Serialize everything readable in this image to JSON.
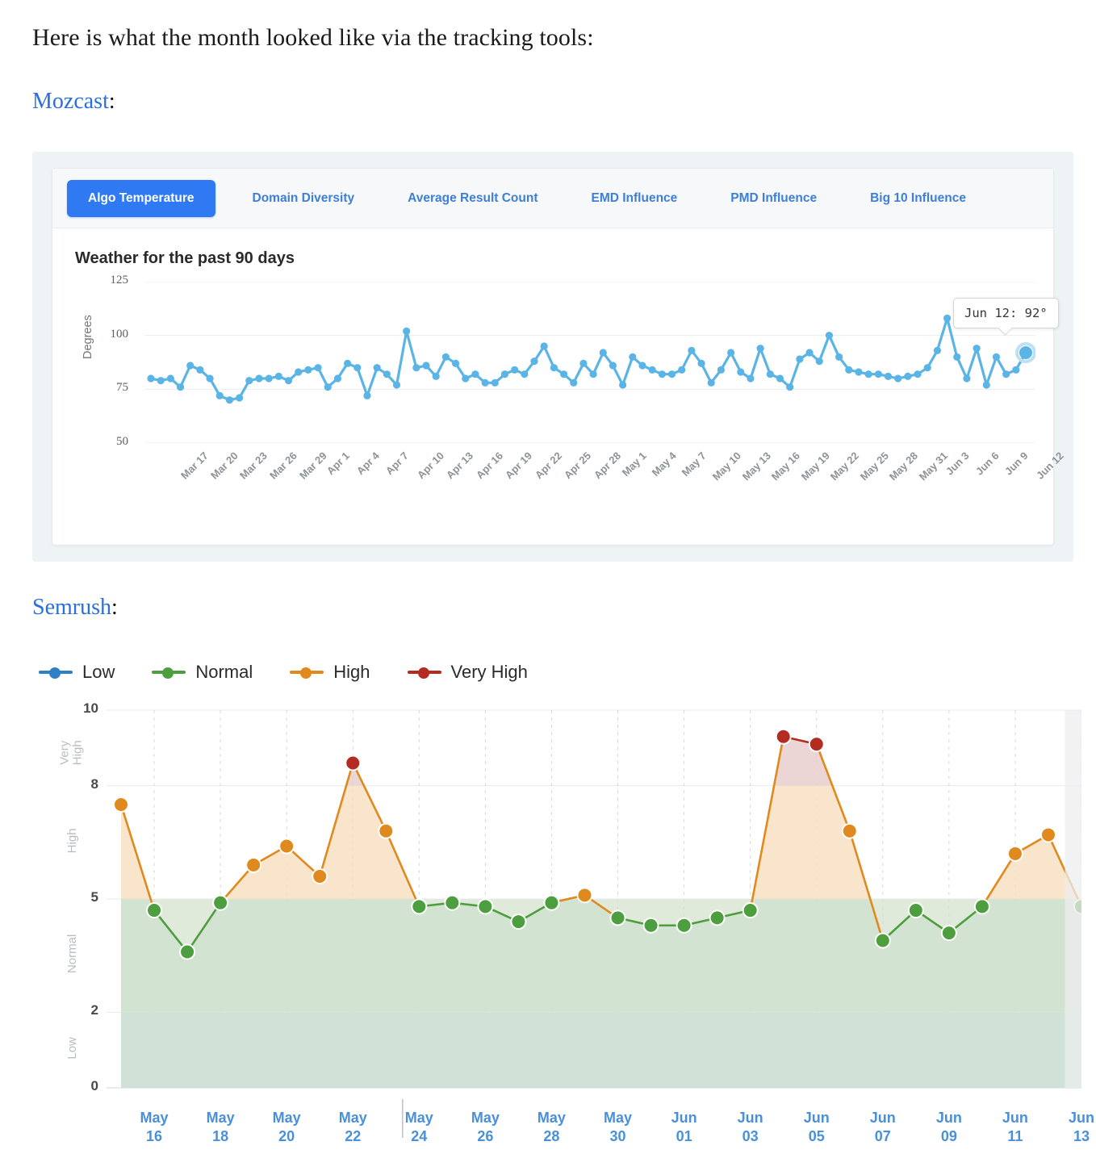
{
  "intro": {
    "paragraph": "Here is what the month looked like via the tracking tools:",
    "mozcast_label": "Mozcast",
    "mozcast_colon": ":",
    "semrush_label": "Semrush",
    "semrush_colon": ":"
  },
  "colors": {
    "link": "#2b6fdd",
    "tab_active_bg": "#2f7af3",
    "tab_text": "#3d7fd6",
    "mozcast_line": "#5ab4e5",
    "low": "#2f80c4",
    "normal": "#4d9e3f",
    "high": "#e08a1e",
    "very_high": "#b42b22",
    "band_low": "#d4e4f2",
    "band_normal": "#dfeada",
    "band_high": "#ffffff",
    "today_overlay": "#eceeef"
  },
  "mozcast": {
    "tabs": [
      {
        "label": "Algo Temperature",
        "active": true
      },
      {
        "label": "Domain Diversity",
        "active": false
      },
      {
        "label": "Average Result Count",
        "active": false
      },
      {
        "label": "EMD Influence",
        "active": false
      },
      {
        "label": "PMD Influence",
        "active": false
      },
      {
        "label": "Big 10 Influence",
        "active": false
      }
    ],
    "tooltip": "Jun 12: 92°",
    "chart_data": {
      "type": "line",
      "title": "Weather for the past 90 days",
      "xlabel": "",
      "ylabel": "Degrees",
      "ylim": [
        50,
        125
      ],
      "yticks": [
        125,
        100,
        75,
        50
      ],
      "grid": true,
      "legend": "none",
      "tick_labels": [
        "Mar 17",
        "Mar 20",
        "Mar 23",
        "Mar 26",
        "Mar 29",
        "Apr 1",
        "Apr 4",
        "Apr 7",
        "Apr 10",
        "Apr 13",
        "Apr 16",
        "Apr 19",
        "Apr 22",
        "Apr 25",
        "Apr 28",
        "May 1",
        "May 4",
        "May 7",
        "May 10",
        "May 13",
        "May 16",
        "May 19",
        "May 22",
        "May 25",
        "May 28",
        "May 31",
        "Jun 3",
        "Jun 6",
        "Jun 9",
        "Jun 12"
      ],
      "tick_every": 3,
      "x_start": "Mar 15",
      "values": [
        80,
        79,
        80,
        76,
        86,
        84,
        80,
        72,
        70,
        71,
        79,
        80,
        80,
        81,
        79,
        83,
        84,
        85,
        76,
        80,
        87,
        85,
        72,
        85,
        82,
        77,
        102,
        85,
        86,
        81,
        90,
        87,
        80,
        82,
        78,
        78,
        82,
        84,
        82,
        88,
        95,
        85,
        82,
        78,
        87,
        82,
        92,
        86,
        77,
        90,
        86,
        84,
        82,
        82,
        84,
        93,
        87,
        78,
        84,
        92,
        83,
        80,
        94,
        82,
        80,
        76,
        89,
        92,
        88,
        100,
        90,
        84,
        83,
        82,
        82,
        81,
        80,
        81,
        82,
        85,
        93,
        108,
        90,
        80,
        94,
        77,
        90,
        82,
        84,
        92
      ],
      "highlight_index": 89,
      "highlight_label": "Jun 12",
      "highlight_value": 92
    }
  },
  "semrush": {
    "legend": [
      {
        "label": "Low",
        "color": "#2f80c4"
      },
      {
        "label": "Normal",
        "color": "#4d9e3f"
      },
      {
        "label": "High",
        "color": "#e08a1e"
      },
      {
        "label": "Very High",
        "color": "#b42b22"
      }
    ],
    "chart_data": {
      "type": "line",
      "title": "",
      "xlabel": "",
      "ylabel": "",
      "ylim": [
        0,
        10
      ],
      "yticks": [
        10,
        8,
        5,
        2,
        0
      ],
      "grid": true,
      "legend_position": "top-left",
      "bands": [
        {
          "label": "Very High",
          "from": 8,
          "to": 10,
          "color": "#ffffff"
        },
        {
          "label": "High",
          "from": 5,
          "to": 8,
          "color": "#ffffff"
        },
        {
          "label": "Normal",
          "from": 2,
          "to": 5,
          "color": "#dfeada"
        },
        {
          "label": "Low",
          "from": 0,
          "to": 2,
          "color": "#d4e4f2"
        }
      ],
      "categories": [
        "May 15",
        "May 16",
        "May 17",
        "May 18",
        "May 19",
        "May 20",
        "May 21",
        "May 22",
        "May 23",
        "May 24",
        "May 25",
        "May 26",
        "May 27",
        "May 28",
        "May 29",
        "May 30",
        "May 31",
        "Jun 01",
        "Jun 02",
        "Jun 03",
        "Jun 04",
        "Jun 05",
        "Jun 06",
        "Jun 07",
        "Jun 08",
        "Jun 09",
        "Jun 10",
        "Jun 11",
        "Jun 12",
        "Jun 13"
      ],
      "tick_labels": [
        {
          "month": "May",
          "day": "16"
        },
        {
          "month": "May",
          "day": "18"
        },
        {
          "month": "May",
          "day": "20"
        },
        {
          "month": "May",
          "day": "22"
        },
        {
          "month": "May",
          "day": "24"
        },
        {
          "month": "May",
          "day": "26"
        },
        {
          "month": "May",
          "day": "28"
        },
        {
          "month": "May",
          "day": "30"
        },
        {
          "month": "Jun",
          "day": "01"
        },
        {
          "month": "Jun",
          "day": "03"
        },
        {
          "month": "Jun",
          "day": "05"
        },
        {
          "month": "Jun",
          "day": "07"
        },
        {
          "month": "Jun",
          "day": "09"
        },
        {
          "month": "Jun",
          "day": "11"
        },
        {
          "month": "Jun",
          "day": "13"
        }
      ],
      "values": [
        7.5,
        4.7,
        3.6,
        4.9,
        5.9,
        6.4,
        5.6,
        8.6,
        6.8,
        4.8,
        4.9,
        4.8,
        4.4,
        4.9,
        5.1,
        4.5,
        4.3,
        4.3,
        4.5,
        4.7,
        9.3,
        9.1,
        6.8,
        3.9,
        4.7,
        4.1,
        4.8,
        6.2,
        6.7,
        4.8
      ],
      "today_index": 29,
      "today_shaded": true
    }
  }
}
